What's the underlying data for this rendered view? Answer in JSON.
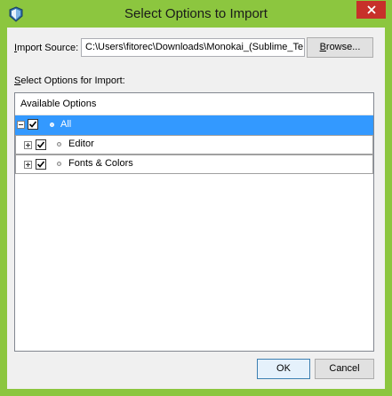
{
  "window": {
    "title": "Select Options to Import",
    "accent_color": "#8cc63f",
    "close_color": "#c7302a"
  },
  "import_source": {
    "label_first": "I",
    "label_rest": "mport Source:",
    "value": "C:\\Users\\fitorec\\Downloads\\Monokai_(Sublime_Te",
    "browse_first": "B",
    "browse_rest": "rowse..."
  },
  "options": {
    "label_first": "S",
    "label_rest": "elect Options for Import:",
    "header": "Available Options",
    "selection_color": "#3399ff",
    "items": [
      {
        "label": "All",
        "checked": true,
        "expander": "collapse",
        "selected": true
      },
      {
        "label": "Editor",
        "checked": true,
        "expander": "expand",
        "selected": false
      },
      {
        "label": "Fonts & Colors",
        "checked": true,
        "expander": "expand",
        "selected": false
      }
    ]
  },
  "buttons": {
    "ok": "OK",
    "cancel": "Cancel"
  }
}
